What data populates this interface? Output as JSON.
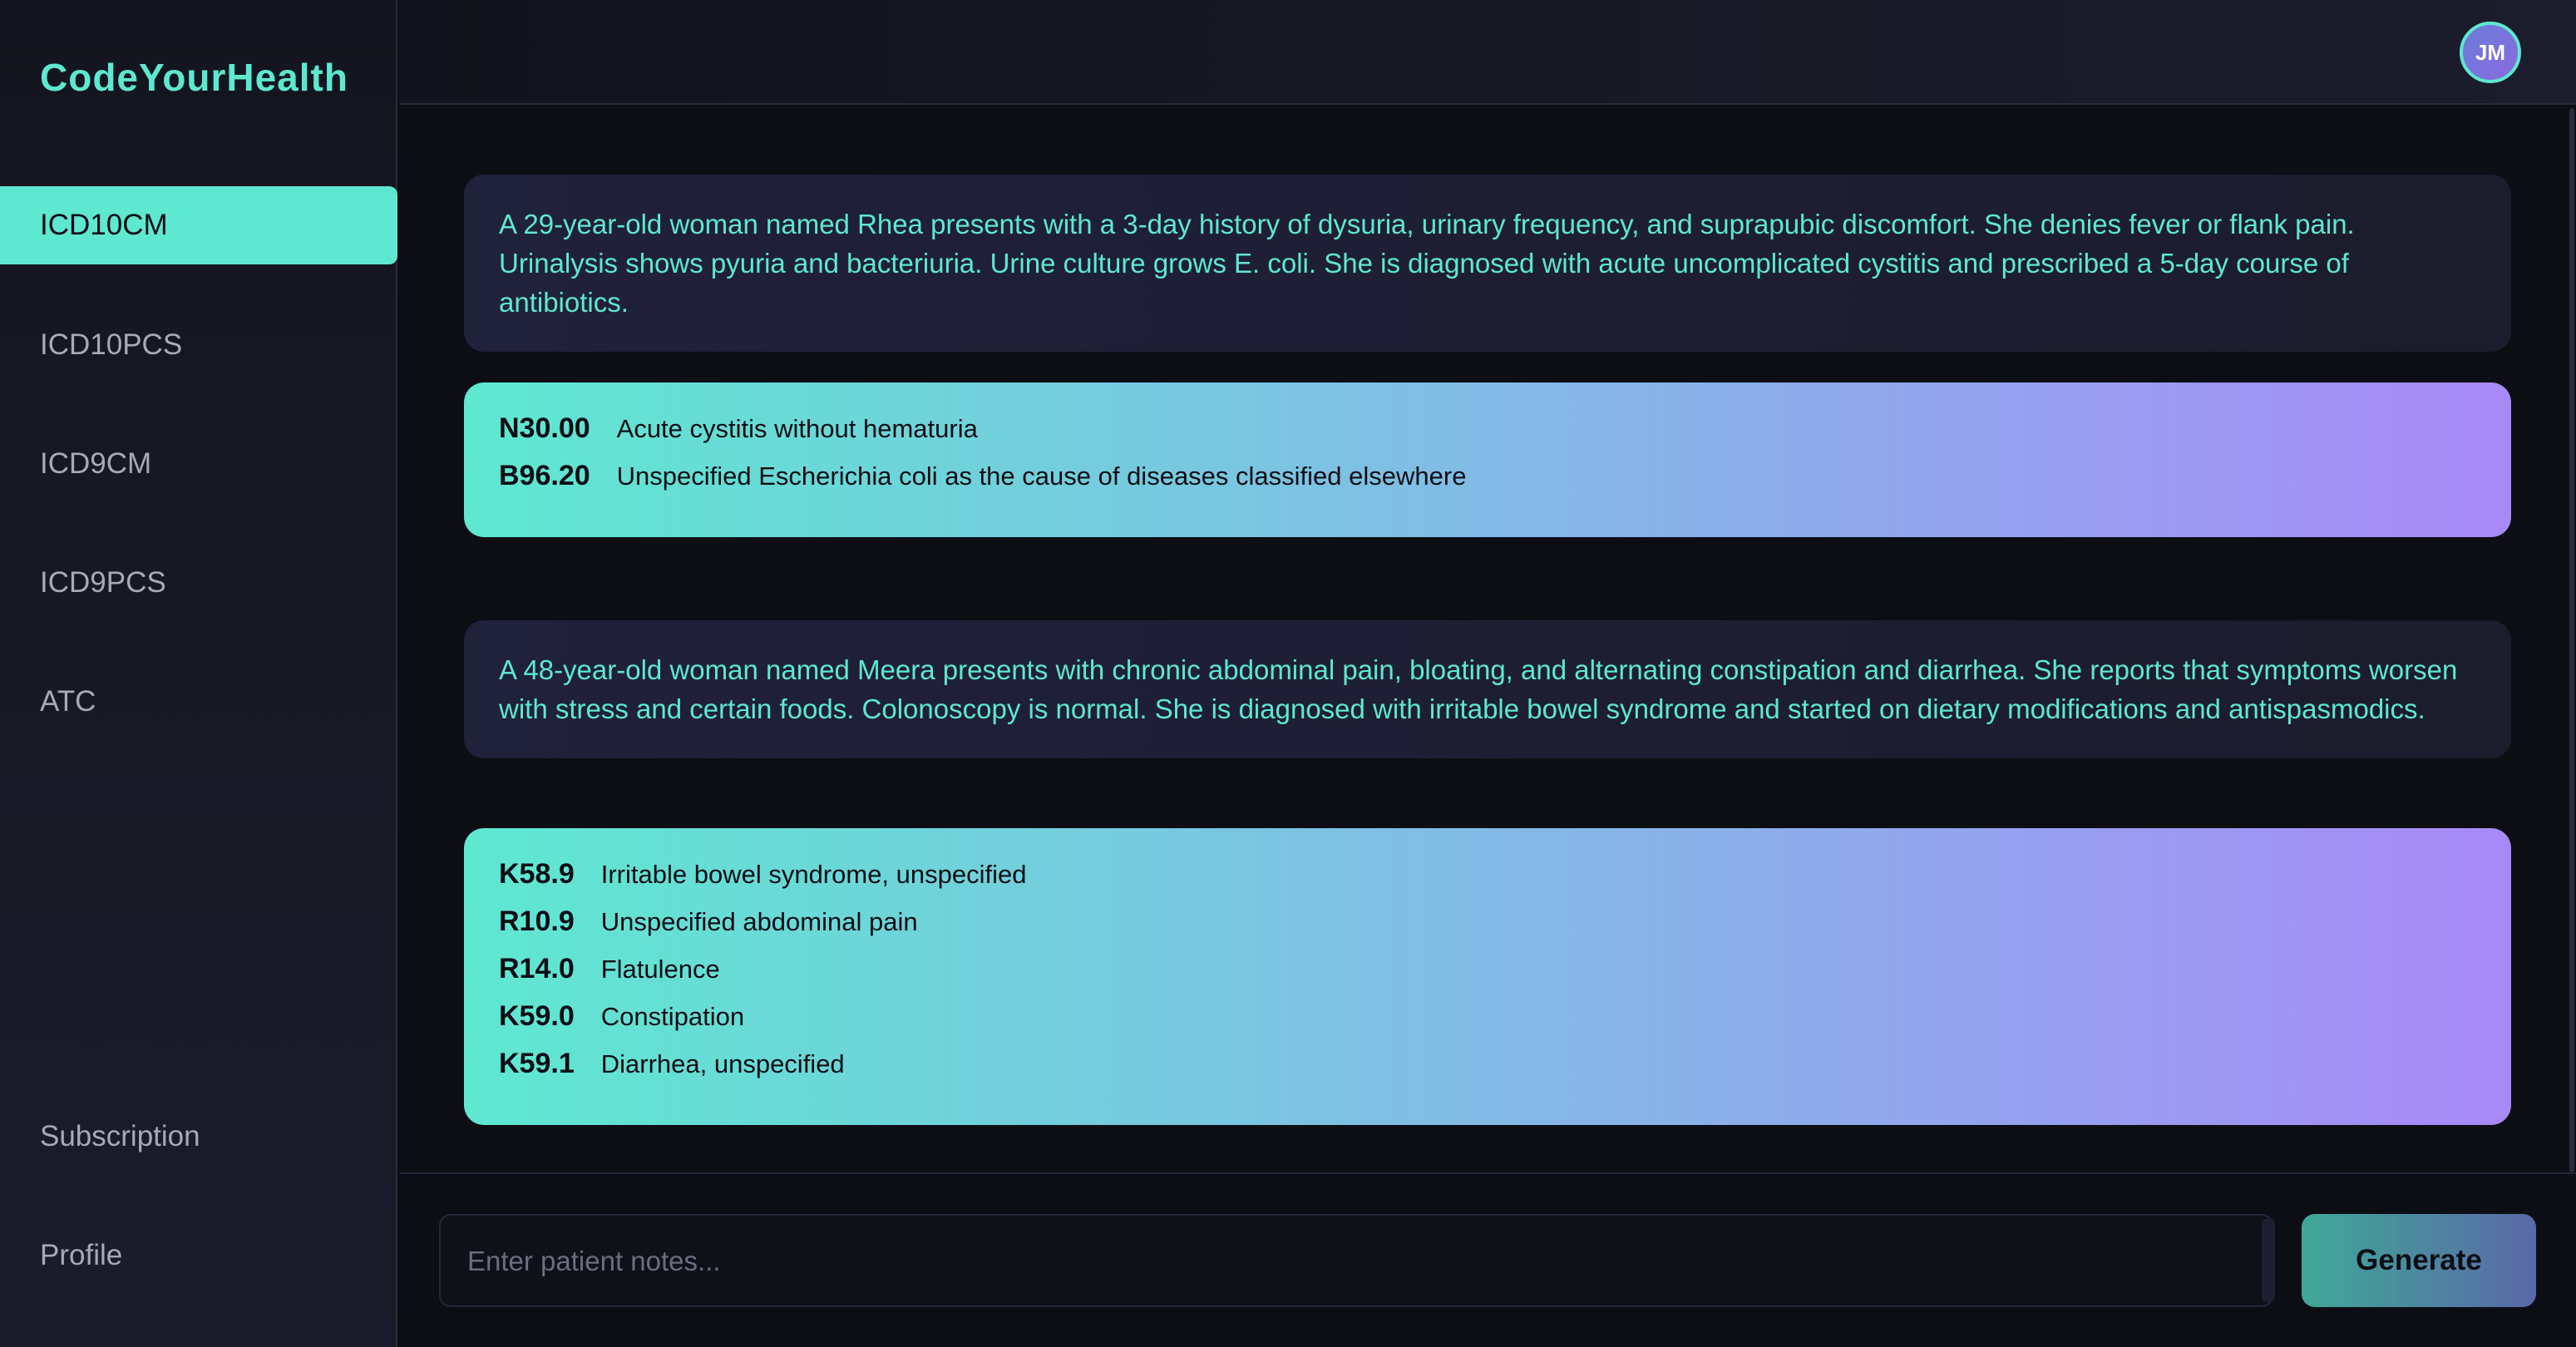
{
  "app": {
    "brand": "CodeYourHealth",
    "avatar_initials": "JM",
    "colors": {
      "accent": "#5ee8d0",
      "gradient_end": "#a889f7",
      "background": "#0d0e14"
    }
  },
  "sidebar": {
    "items": [
      {
        "label": "ICD10CM",
        "active": true
      },
      {
        "label": "ICD10PCS",
        "active": false
      },
      {
        "label": "ICD9CM",
        "active": false
      },
      {
        "label": "ICD9PCS",
        "active": false
      },
      {
        "label": "ATC",
        "active": false
      }
    ],
    "bottom_items": [
      {
        "label": "Subscription"
      },
      {
        "label": "Profile"
      }
    ]
  },
  "conversation": [
    {
      "note": "A 29-year-old woman named Rhea presents with a 3-day history of dysuria, urinary frequency, and suprapubic discomfort. She denies fever or flank pain. Urinalysis shows pyuria and bacteriuria. Urine culture grows E. coli. She is diagnosed with acute uncomplicated cystitis and prescribed a 5-day course of antibiotics.",
      "codes": [
        {
          "code": "N30.00",
          "description": "Acute cystitis without hematuria"
        },
        {
          "code": "B96.20",
          "description": "Unspecified Escherichia coli as the cause of diseases classified elsewhere"
        }
      ]
    },
    {
      "note": "A 48-year-old woman named Meera presents with chronic abdominal pain, bloating, and alternating constipation and diarrhea. She reports that symptoms worsen with stress and certain foods. Colonoscopy is normal. She is diagnosed with irritable bowel syndrome and started on dietary modifications and antispasmodics.",
      "codes": [
        {
          "code": "K58.9",
          "description": "Irritable bowel syndrome, unspecified"
        },
        {
          "code": "R10.9",
          "description": "Unspecified abdominal pain"
        },
        {
          "code": "R14.0",
          "description": "Flatulence"
        },
        {
          "code": "K59.0",
          "description": "Constipation"
        },
        {
          "code": "K59.1",
          "description": "Diarrhea, unspecified"
        }
      ]
    }
  ],
  "input": {
    "placeholder": "Enter patient notes...",
    "value": ""
  },
  "generate_button": {
    "label": "Generate"
  }
}
